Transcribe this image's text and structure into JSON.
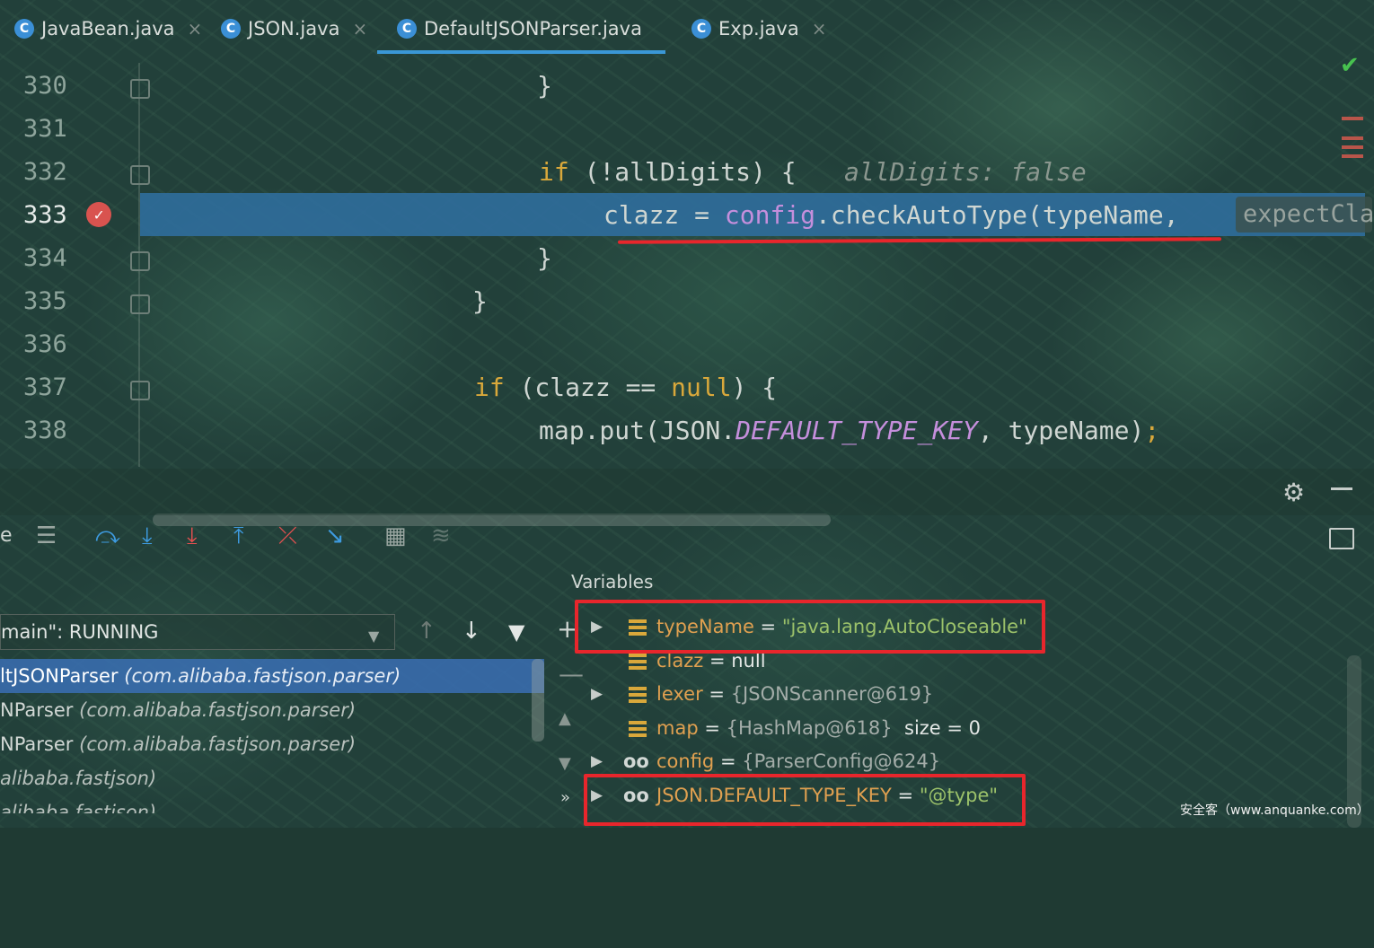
{
  "tabs": [
    {
      "label": "JavaBean.java",
      "icon_letter": "C"
    },
    {
      "label": "JSON.java",
      "icon_letter": "C"
    },
    {
      "label": "DefaultJSONParser.java",
      "icon_letter": "C",
      "active": true
    },
    {
      "label": "Exp.java",
      "icon_letter": "C"
    }
  ],
  "tab_close_glyph": "×",
  "editor": {
    "lines": [
      {
        "number": "330",
        "code": "}"
      },
      {
        "number": "331",
        "code": ""
      },
      {
        "number": "332",
        "kw": "if",
        "code": " (!allDigits) {",
        "hint": "allDigits: false"
      },
      {
        "number": "333",
        "var": "clazz",
        "op": " = ",
        "field": "config",
        "code": ".checkAutoType(typeName,",
        "inlay": "expectClass"
      },
      {
        "number": "334",
        "code": "}"
      },
      {
        "number": "335",
        "code": "}"
      },
      {
        "number": "336",
        "code": ""
      },
      {
        "number": "337",
        "kw": "if",
        "code": " (clazz == ",
        "kw2": "null",
        "code2": ") {"
      },
      {
        "number": "338",
        "code": "map.put(JSON.",
        "const": "DEFAULT_TYPE_KEY",
        "code2": ", typeName)",
        "semi": ";"
      }
    ],
    "breakpoint_icon": "checked-breakpoint-icon"
  },
  "debug": {
    "frames_label": "e",
    "thread": "main\": RUNNING",
    "frames": [
      {
        "method": "ltJSONParser",
        "pkg": "(com.alibaba.fastjson.parser)",
        "selected": true
      },
      {
        "method": "NParser",
        "pkg": "(com.alibaba.fastjson.parser)"
      },
      {
        "method": "NParser",
        "pkg": "(com.alibaba.fastjson.parser)"
      },
      {
        "method": "",
        "pkg": "alibaba.fastjson)"
      },
      {
        "method": "",
        "pkg": "alibaba.fastjson)"
      }
    ],
    "variables_title": "Variables",
    "variables": [
      {
        "name": "typeName",
        "eq": " = ",
        "value": "\"java.lang.AutoCloseable\"",
        "kind": "string",
        "expandable": true,
        "icon": "field"
      },
      {
        "name": "clazz",
        "eq": " = ",
        "value": "null",
        "kind": "plain",
        "expandable": false,
        "icon": "field"
      },
      {
        "name": "lexer",
        "eq": " = ",
        "value": "{JSONScanner@619}",
        "kind": "ref",
        "expandable": true,
        "icon": "field"
      },
      {
        "name": "map",
        "eq": " = ",
        "value": "{HashMap@618}",
        "extra": "  size = 0",
        "kind": "ref",
        "expandable": false,
        "icon": "field"
      },
      {
        "name": "config",
        "eq": " = ",
        "value": "{ParserConfig@624}",
        "kind": "ref",
        "expandable": true,
        "icon": "watch"
      },
      {
        "name": "JSON.DEFAULT_TYPE_KEY",
        "eq": " = ",
        "value": "\"@type\"",
        "kind": "string",
        "expandable": true,
        "icon": "watch"
      }
    ]
  },
  "watermark": "安全客（www.anquanke.com）",
  "colors": {
    "accent": "#3a97d6",
    "highlight": "#2f6c9a",
    "annotation_red": "#e8262c"
  }
}
